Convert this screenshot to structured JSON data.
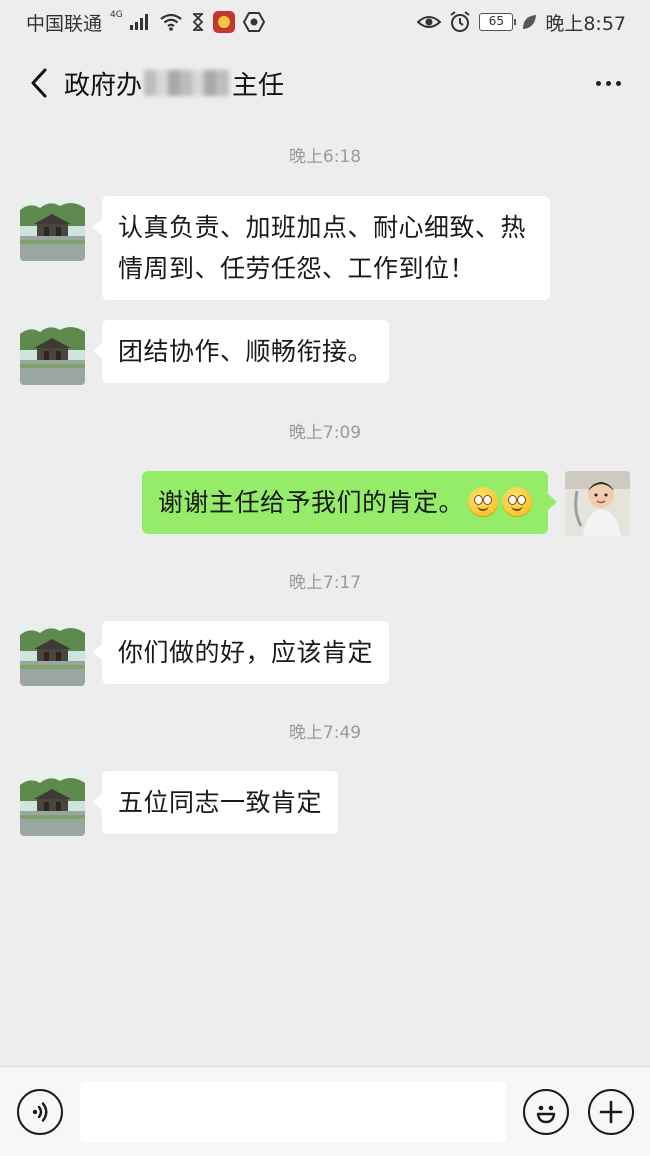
{
  "status_bar": {
    "carrier": "中国联通",
    "network_tag": "4G",
    "battery": "65",
    "time": "晚上8:57"
  },
  "header": {
    "title_prefix": "政府办",
    "title_suffix": "主任"
  },
  "messages": [
    {
      "type": "time",
      "text": "晚上6:18"
    },
    {
      "type": "msg",
      "side": "in",
      "text": "认真负责、加班加点、耐心细致、热情周到、任劳任怨、工作到位！"
    },
    {
      "type": "msg",
      "side": "in",
      "text": "团结协作、顺畅衔接。"
    },
    {
      "type": "time",
      "text": "晚上7:09"
    },
    {
      "type": "msg",
      "side": "out",
      "text": "谢谢主任给予我们的肯定。",
      "emoji": "smile-emoji x2"
    },
    {
      "type": "time",
      "text": "晚上7:17"
    },
    {
      "type": "msg",
      "side": "in",
      "text": "你们做的好，应该肯定"
    },
    {
      "type": "time",
      "text": "晚上7:49"
    },
    {
      "type": "msg",
      "side": "in",
      "text": "五位同志一致肯定"
    }
  ],
  "input_bar": {
    "value": "",
    "voice_icon": "voice-icon",
    "emoji_icon": "emoji-icon",
    "plus_icon": "plus-icon"
  },
  "colors": {
    "background": "#ededed",
    "bubble_in": "#ffffff",
    "bubble_out": "#95ec69",
    "timestamp": "#9a9a9a"
  }
}
